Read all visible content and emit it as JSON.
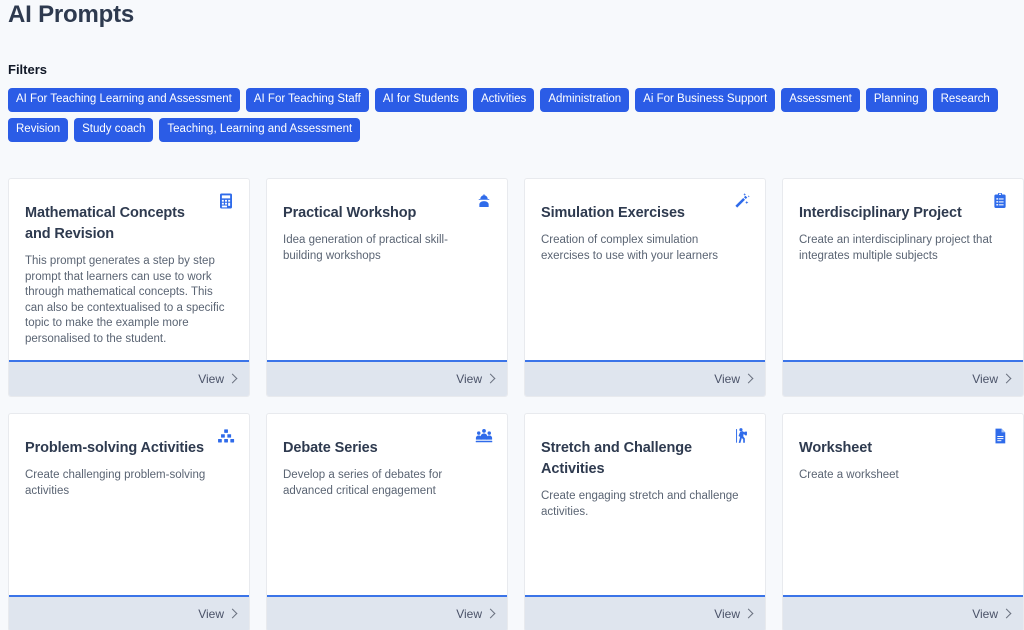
{
  "header": {
    "title": "AI Prompts",
    "filters_label": "Filters"
  },
  "colors": {
    "tag_blue": "#2b5ce6",
    "icon_blue": "#2f6bea",
    "footer_bg": "#dfe5ee",
    "footer_border": "#3b74e8",
    "page_bg": "#f7f9fc",
    "title_navy": "#2e3a4f"
  },
  "filters": [
    {
      "label": "AI For Teaching Learning and Assessment"
    },
    {
      "label": "AI For Teaching Staff"
    },
    {
      "label": "AI for Students"
    },
    {
      "label": "Activities"
    },
    {
      "label": "Administration"
    },
    {
      "label": "Ai For Business Support"
    },
    {
      "label": "Assessment"
    },
    {
      "label": "Planning"
    },
    {
      "label": "Research"
    },
    {
      "label": "Revision"
    },
    {
      "label": "Study coach"
    },
    {
      "label": "Teaching, Learning and Assessment"
    }
  ],
  "cards": [
    {
      "title": "Mathematical Concepts and Revision",
      "description": "This prompt generates a step by step prompt that learners can use to work through mathematical concepts. This can also be contextualised to a specific topic to make the example more personalised to the student.",
      "icon": "calculator-icon",
      "view_label": "View"
    },
    {
      "title": "Practical Workshop",
      "description": "Idea generation of practical skill-building workshops",
      "icon": "hard-hat-worker-icon",
      "view_label": "View"
    },
    {
      "title": "Simulation Exercises",
      "description": "Creation of complex simulation exercises to use with your learners",
      "icon": "magic-wand-icon",
      "view_label": "View"
    },
    {
      "title": "Interdisciplinary Project",
      "description": "Create an interdisciplinary project that integrates multiple subjects",
      "icon": "clipboard-list-icon",
      "view_label": "View"
    },
    {
      "title": "Problem-solving Activities",
      "description": "Create challenging problem-solving activities",
      "icon": "stacked-blocks-icon",
      "view_label": "View"
    },
    {
      "title": "Debate Series",
      "description": "Develop a series of debates for advanced critical engagement",
      "icon": "group-people-icon",
      "view_label": "View"
    },
    {
      "title": "Stretch and Challenge Activities",
      "description": "Create engaging stretch and challenge activities.",
      "icon": "hiking-person-icon",
      "view_label": "View"
    },
    {
      "title": "Worksheet",
      "description": "Create a worksheet",
      "icon": "document-icon",
      "view_label": "View"
    }
  ]
}
